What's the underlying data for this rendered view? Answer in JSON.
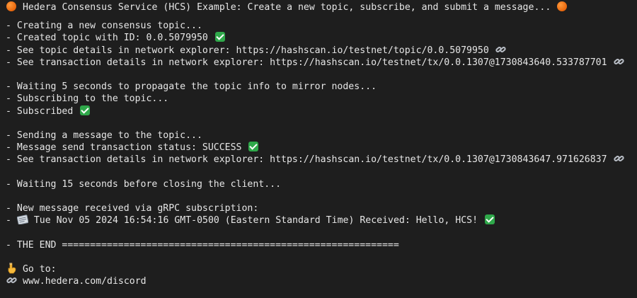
{
  "header": {
    "title": " Hedera Consensus Service (HCS) Example: Create a new topic, subscribe, and submit a message... "
  },
  "topic": {
    "creating": "- Creating a new consensus topic...",
    "created_prefix": "- Created topic with ID: 0.0.5079950 ",
    "topic_explorer_prefix": "- See topic details in network explorer: ",
    "topic_url": "https://hashscan.io/testnet/topic/0.0.5079950",
    "tx_explorer_prefix": "- See transaction details in network explorer: ",
    "tx_url": "https://hashscan.io/testnet/tx/0.0.1307@1730843640.533787701"
  },
  "subscribe": {
    "waiting": "- Waiting 5 seconds to propagate the topic info to mirror nodes...",
    "subscribing": "- Subscribing to the topic...",
    "subscribed": "- Subscribed "
  },
  "message": {
    "sending": "- Sending a message to the topic...",
    "status": "- Message send transaction status: SUCCESS ",
    "tx_explorer_prefix": "- See transaction details in network explorer: ",
    "tx_url": "https://hashscan.io/testnet/tx/0.0.1307@1730843647.971626837"
  },
  "closing": {
    "waiting": "- Waiting 15 seconds before closing the client..."
  },
  "received": {
    "header": "- New message received via gRPC subscription:",
    "prefix": "- ",
    "text": " Tue Nov 05 2024 16:54:16 GMT-0500 (Eastern Standard Time) Received: Hello, HCS! "
  },
  "end": {
    "text": "- THE END ============================================================"
  },
  "footer": {
    "goto": " Go to:",
    "discord": " www.hedera.com/discord"
  },
  "icons": {
    "orange_circle": "orange-circle-icon",
    "check": "check-icon",
    "link": "link-icon",
    "newspaper": "newspaper-icon",
    "pointing_hand": "pointing-down-hand-icon"
  },
  "colors": {
    "background": "#1e1e1e",
    "text": "#e6e6e6",
    "check": "#2fa84a",
    "orange": "#e8660c"
  }
}
